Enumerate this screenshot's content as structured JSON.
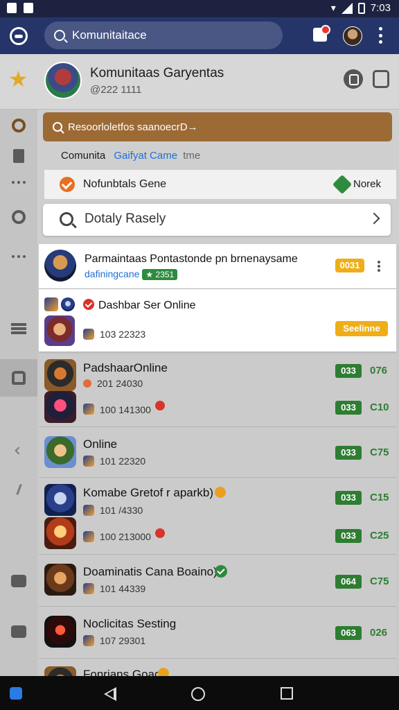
{
  "status_bar": {
    "time": "7:03"
  },
  "app_bar": {
    "search_value": "Komunitaitace"
  },
  "profile": {
    "name": "Komunitaas Garyentas",
    "id": "@222 1111"
  },
  "search_panel": {
    "search_value": "Resoorloletfos saanoecrD→",
    "breadcrumb": [
      "Comunita",
      "Gaifyat Came",
      "tme"
    ],
    "filter_label": "Nofunbtals Gene",
    "filter_note": "Norek",
    "daily_label": "Dotaly Rasely"
  },
  "list": {
    "featured": {
      "title": "Parmaintaas Pontastonde pn brnenaysame",
      "subtitle": "dafiningcane",
      "pill": "★ 2351",
      "badge": "0031"
    },
    "highlight": {
      "title": "Dashbar Ser Online",
      "meta": "103 22323",
      "badge": "Seelinne"
    },
    "rows": [
      {
        "title": "PadshaarOnline",
        "meta1": "201 24030",
        "meta2": "100 141300",
        "badge1": "033",
        "num1": "076",
        "badge2": "033",
        "num2": "C10"
      },
      {
        "title": "Online",
        "meta1": "101 22320",
        "badge1": "033",
        "num1": "C75"
      },
      {
        "title": "Komabe Gretof r aparkb)",
        "meta1": "101 /4330",
        "meta2": "100 213000",
        "badge1": "033",
        "num1": "C15",
        "badge2": "033",
        "num2": "C25"
      },
      {
        "title": "Doaminatis Cana Boaino)",
        "meta1": "101 44339",
        "badge1": "064",
        "num1": "C75"
      },
      {
        "title": "Noclicitas Sesting",
        "meta1": "107 29301",
        "badge1": "063",
        "num1": "026"
      },
      {
        "title": "Fonrians Goad"
      }
    ]
  }
}
